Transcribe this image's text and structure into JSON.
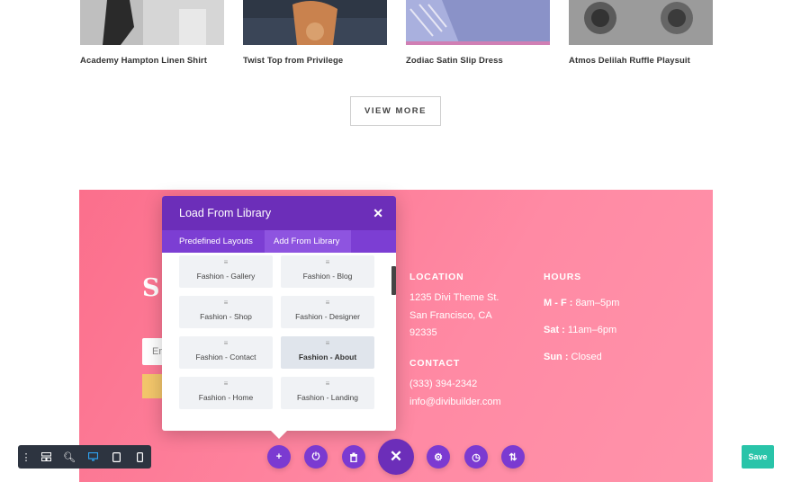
{
  "products": [
    {
      "name": "Academy Hampton Linen Shirt"
    },
    {
      "name": "Twist Top from Privilege"
    },
    {
      "name": "Zodiac Satin Slip Dress"
    },
    {
      "name": "Atmos Delilah Ruffle Playsuit"
    }
  ],
  "view_more_label": "VIEW MORE",
  "section": {
    "headline_fragment": "S",
    "email_placeholder_fragment": "Em",
    "location": {
      "heading": "LOCATION",
      "line1": "1235 Divi Theme St.",
      "line2": "San Francisco, CA",
      "line3": "92335"
    },
    "contact": {
      "heading": "CONTACT",
      "phone": "(333) 394-2342",
      "email": "info@divibuilder.com"
    },
    "hours": {
      "heading": "HOURS",
      "rows": [
        {
          "day": "M - F :",
          "time": " 8am–5pm"
        },
        {
          "day": "Sat :",
          "time": " 11am–6pm"
        },
        {
          "day": "Sun :",
          "time": " Closed"
        }
      ]
    }
  },
  "modal": {
    "title": "Load From Library",
    "tabs": [
      "Predefined Layouts",
      "Add From Library"
    ],
    "layouts": [
      "Fashion - Gallery",
      "Fashion - Blog",
      "Fashion - Shop",
      "Fashion - Designer",
      "Fashion - Contact",
      "Fashion - About",
      "Fashion - Home",
      "Fashion - Landing"
    ]
  },
  "save_label": "Save",
  "colors": {
    "accent": "#6c2eb9",
    "pink": "#fb6f8c",
    "save": "#29c4a9",
    "toolbar": "#2d3440"
  }
}
